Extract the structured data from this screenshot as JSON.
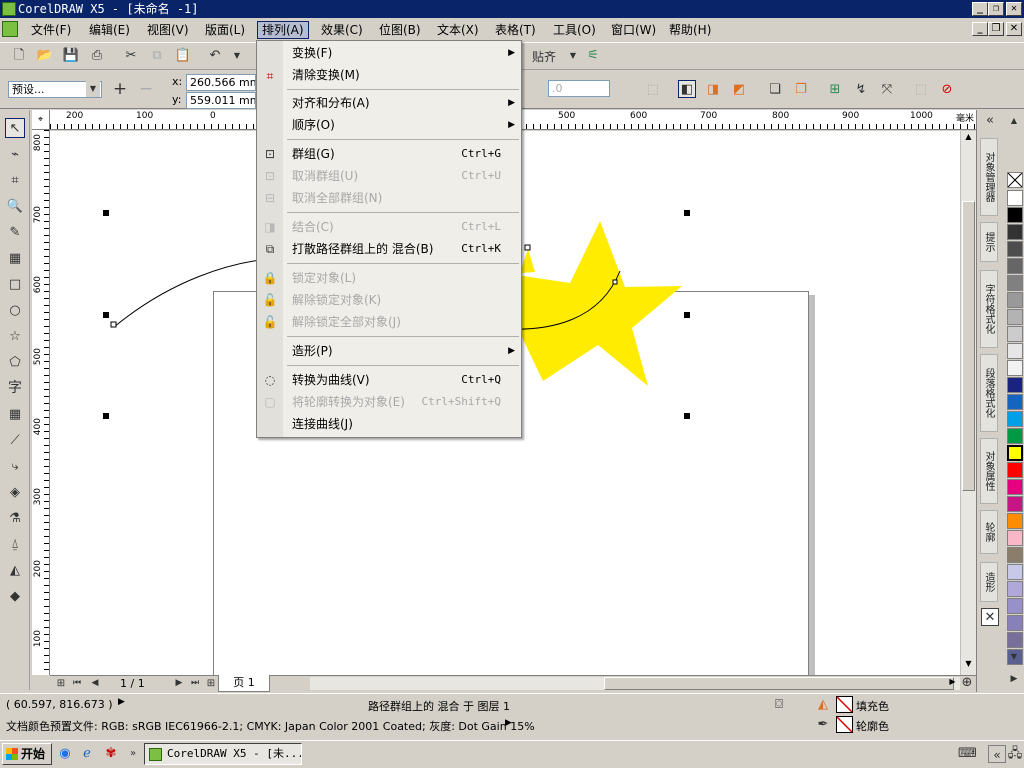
{
  "window": {
    "title": "CorelDRAW X5 - [未命名 -1]",
    "min": "_",
    "restore": "❐",
    "close": "✕"
  },
  "menu": [
    {
      "label": "文件(F)"
    },
    {
      "label": "编辑(E)"
    },
    {
      "label": "视图(V)"
    },
    {
      "label": "版面(L)"
    },
    {
      "label": "排列(A)"
    },
    {
      "label": "效果(C)"
    },
    {
      "label": "位图(B)"
    },
    {
      "label": "文本(X)"
    },
    {
      "label": "表格(T)"
    },
    {
      "label": "工具(O)"
    },
    {
      "label": "窗口(W)"
    },
    {
      "label": "帮助(H)"
    }
  ],
  "toolbar": {
    "snap_label": "贴齐",
    "preset_value": "预设...",
    "x_label": "x:",
    "x_value": "260.566 mm",
    "y_label": "y:",
    "y_value": "559.011 mm",
    "offset_value": ".0"
  },
  "ruler": {
    "unit": "毫米",
    "h_labels": [
      "200",
      "100",
      "0",
      "500",
      "600",
      "700",
      "800",
      "900",
      "1000"
    ],
    "v_labels": [
      "800",
      "700",
      "600",
      "500",
      "400",
      "300",
      "200",
      "100"
    ]
  },
  "arrange_menu": {
    "items": [
      {
        "label": "变换(F)",
        "shortcut": "",
        "disabled": false,
        "submenu": true
      },
      {
        "label": "清除变换(M)",
        "shortcut": "",
        "disabled": false,
        "submenu": false
      },
      {
        "label": "对齐和分布(A)",
        "shortcut": "",
        "disabled": false,
        "submenu": true
      },
      {
        "label": "顺序(O)",
        "shortcut": "",
        "disabled": false,
        "submenu": true
      },
      {
        "label": "群组(G)",
        "shortcut": "Ctrl+G",
        "disabled": false,
        "submenu": false
      },
      {
        "label": "取消群组(U)",
        "shortcut": "Ctrl+U",
        "disabled": true,
        "submenu": false
      },
      {
        "label": "取消全部群组(N)",
        "shortcut": "",
        "disabled": true,
        "submenu": false
      },
      {
        "label": "结合(C)",
        "shortcut": "Ctrl+L",
        "disabled": true,
        "submenu": false
      },
      {
        "label": "打散路径群组上的  混合(B)",
        "shortcut": "Ctrl+K",
        "disabled": false,
        "submenu": false
      },
      {
        "label": "锁定对象(L)",
        "shortcut": "",
        "disabled": true,
        "submenu": false
      },
      {
        "label": "解除锁定对象(K)",
        "shortcut": "",
        "disabled": true,
        "submenu": false
      },
      {
        "label": "解除锁定全部对象(J)",
        "shortcut": "",
        "disabled": true,
        "submenu": false
      },
      {
        "label": "造形(P)",
        "shortcut": "",
        "disabled": false,
        "submenu": true
      },
      {
        "label": "转换为曲线(V)",
        "shortcut": "Ctrl+Q",
        "disabled": false,
        "submenu": false
      },
      {
        "label": "将轮廓转换为对象(E)",
        "shortcut": "Ctrl+Shift+Q",
        "disabled": true,
        "submenu": false
      },
      {
        "label": "连接曲线(J)",
        "shortcut": "",
        "disabled": false,
        "submenu": false
      }
    ]
  },
  "dockers": [
    "对象管理器",
    "提示",
    "字符格式化",
    "段落格式化",
    "对象属性",
    "轮廓",
    "造形"
  ],
  "palette": [
    "#ffffff",
    "#000000",
    "#333333",
    "#4d4d4d",
    "#666666",
    "#808080",
    "#999999",
    "#b3b3b3",
    "#cccccc",
    "#e6e6e6",
    "#f2f2f2",
    "#1a237e",
    "#1565c0",
    "#00a0e9",
    "#009944",
    "#ffff00",
    "#ff0000",
    "#e4007f",
    "#c71585",
    "#ff8c00",
    "#f7b8c8",
    "#8b7d6b",
    "#c8c8e8",
    "#b0a8d8",
    "#9890c8",
    "#8880b8",
    "#787098",
    "#5a6090"
  ],
  "pager": {
    "count": "1 / 1",
    "tab": "页 1"
  },
  "status": {
    "coords": "( 60.597, 816.673 )",
    "selection": "路径群组上的 混合 于 图层 1",
    "fill_label": "填充色",
    "outline_label": "轮廓色",
    "color_profile": "文档颜色预置文件: RGB: sRGB IEC61966-2.1; CMYK: Japan Color 2001 Coated; 灰度: Dot Gain 15%"
  },
  "taskbar": {
    "start": "开始",
    "task": "CorelDRAW X5 - [未..."
  },
  "colors": {
    "star": "#ffec00",
    "titlebar": "#0a246a"
  }
}
